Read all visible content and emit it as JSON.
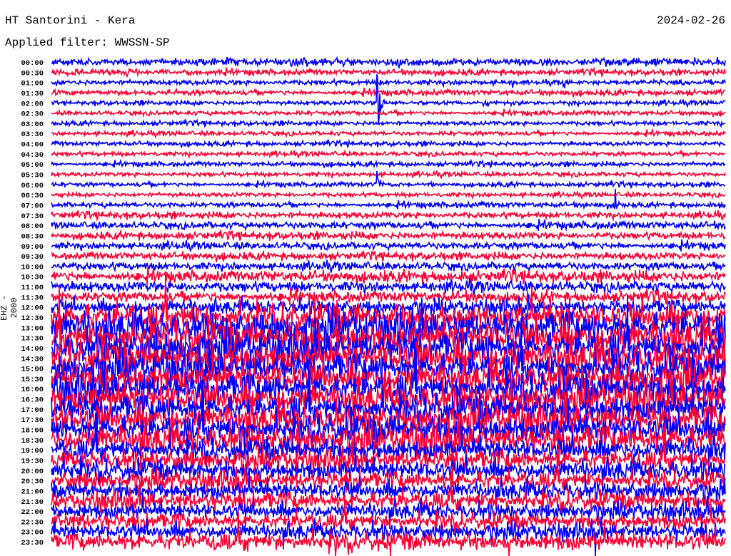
{
  "header": {
    "station": "HT Santorini - Kera",
    "date": "2024-02-26",
    "filter": "Applied filter: WWSSN-SP",
    "channel": "EHZ - 2000"
  },
  "chart_data": {
    "type": "line",
    "title": "HT Santorini - Kera",
    "subtitle": "Applied filter: WWSSN-SP",
    "ylabel": "EHZ - 2000",
    "row_minutes": 30,
    "colors": [
      "#0000ff",
      "#ff0033"
    ],
    "rows": [
      {
        "label": "00:00",
        "level": 4
      },
      {
        "label": "00:30",
        "level": 3
      },
      {
        "label": "01:00",
        "level": 3
      },
      {
        "label": "01:30",
        "level": 3
      },
      {
        "label": "02:00",
        "level": 2.5
      },
      {
        "label": "02:30",
        "level": 2.5
      },
      {
        "label": "03:00",
        "level": 2.5
      },
      {
        "label": "03:30",
        "level": 2.5
      },
      {
        "label": "04:00",
        "level": 2.5
      },
      {
        "label": "04:30",
        "level": 2.5
      },
      {
        "label": "05:00",
        "level": 2.5
      },
      {
        "label": "05:30",
        "level": 2.5
      },
      {
        "label": "06:00",
        "level": 2.5
      },
      {
        "label": "06:30",
        "level": 2.5
      },
      {
        "label": "07:00",
        "level": 3
      },
      {
        "label": "07:30",
        "level": 3.5
      },
      {
        "label": "08:00",
        "level": 4
      },
      {
        "label": "08:30",
        "level": 4
      },
      {
        "label": "09:00",
        "level": 4
      },
      {
        "label": "09:30",
        "level": 4
      },
      {
        "label": "10:00",
        "level": 4.5
      },
      {
        "label": "10:30",
        "level": 6
      },
      {
        "label": "11:00",
        "level": 6
      },
      {
        "label": "11:30",
        "level": 6
      },
      {
        "label": "12:00",
        "level": 7
      },
      {
        "label": "12:30",
        "level": 14
      },
      {
        "label": "13:00",
        "level": 16
      },
      {
        "label": "13:30",
        "level": 16
      },
      {
        "label": "14:00",
        "level": 16
      },
      {
        "label": "14:30",
        "level": 16
      },
      {
        "label": "15:00",
        "level": 15
      },
      {
        "label": "15:30",
        "level": 15
      },
      {
        "label": "16:00",
        "level": 15
      },
      {
        "label": "16:30",
        "level": 15
      },
      {
        "label": "17:00",
        "level": 14
      },
      {
        "label": "17:30",
        "level": 14
      },
      {
        "label": "18:00",
        "level": 14
      },
      {
        "label": "18:30",
        "level": 14
      },
      {
        "label": "19:00",
        "level": 11
      },
      {
        "label": "19:30",
        "level": 10
      },
      {
        "label": "20:00",
        "level": 10
      },
      {
        "label": "20:30",
        "level": 9
      },
      {
        "label": "21:00",
        "level": 9
      },
      {
        "label": "21:30",
        "level": 9
      },
      {
        "label": "22:00",
        "level": 8
      },
      {
        "label": "22:30",
        "level": 8
      },
      {
        "label": "23:00",
        "level": 8
      },
      {
        "label": "23:30",
        "level": 9
      }
    ],
    "events": [
      {
        "row": "02:00",
        "minute": 14.5,
        "amplitude": 60
      },
      {
        "row": "06:00",
        "minute": 14.5,
        "amplitude": 25
      },
      {
        "row": "07:00",
        "minute": 25.1,
        "amplitude": 30
      },
      {
        "row": "01:00",
        "minute": 20.5,
        "amplitude": 8
      },
      {
        "row": "01:00",
        "minute": 22.8,
        "amplitude": 8
      },
      {
        "row": "09:30",
        "minute": 25.2,
        "amplitude": 14
      }
    ]
  }
}
